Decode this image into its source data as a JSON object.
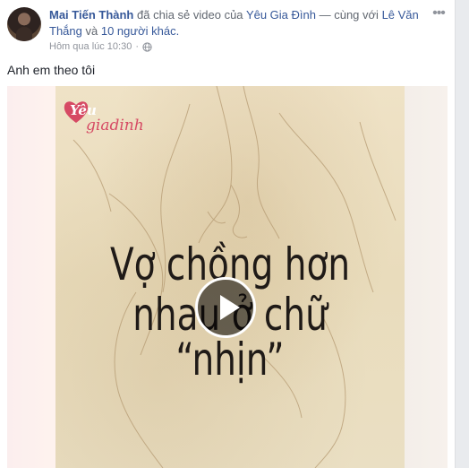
{
  "post": {
    "author": "Mai Tiến Thành",
    "action": "đã chia sẻ video của",
    "page": "Yêu Gia Đình",
    "with_prefix": "— cùng với",
    "tagged": "Lê Văn Thắng",
    "and": "và",
    "others": "10 người khác.",
    "timestamp": "Hôm qua lúc 10:30",
    "separator": "·",
    "privacy_icon": "globe-icon",
    "more_icon": "ellipsis-icon",
    "text": "Anh em theo tôi"
  },
  "video": {
    "logo_prefix": "Yêu",
    "logo_suffix": "giadinh",
    "title_line1": "Vợ chồng hơn",
    "title_line2": "nhau ở chữ",
    "title_line3": "“nhịn”",
    "play_icon": "play-icon"
  },
  "colors": {
    "link": "#365899",
    "text": "#1d2129",
    "muted": "#90949c",
    "logo": "#d64a64"
  }
}
